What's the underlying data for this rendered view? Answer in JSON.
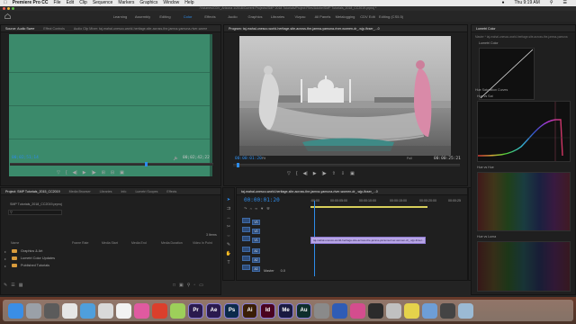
{
  "menubar": {
    "apple": "",
    "app": "Premiere Pro CC",
    "items": [
      "File",
      "Edit",
      "Clip",
      "Sequence",
      "Markers",
      "Graphics",
      "Window",
      "Help"
    ],
    "clock": "Thu 9:19 AM"
  },
  "titlebar": {
    "path": "/Volumes/CDV_Arizona 1/2018/Current Projects/SMP 2018 Tutorials/Project Files/Adobe/SMP Tutorials_2018_CC2019.prproj *"
  },
  "workspaces": {
    "tabs": [
      "Learning",
      "Assembly",
      "Editing",
      "Color",
      "Effects",
      "Audio",
      "Graphics",
      "Libraries",
      "Vizpac",
      "All Panels",
      "Metalogging",
      "CDV Edit",
      "Editing (CS5.5)"
    ],
    "active": "Color"
  },
  "source_panel": {
    "tabs": [
      "Source: Audio Swee",
      "Effect Controls",
      "Audio Clip Mixer: taj-mahal-unesco-world-heritage-site-across-the-jamna-yamuna-river-wome"
    ],
    "timecode_left": "00;02;51;14",
    "timecode_right": "00;02;42;22"
  },
  "program_panel": {
    "title": "Program: taj-mahal-unesco-world-heritage-site-across-the-jamna-yamuna-river-women-dr_.wjp-ifcser_...0",
    "timecode_left": "00:00:01:20",
    "fit_label": "Fit",
    "quality_label": "Full",
    "timecode_right": "00:00:25:21"
  },
  "project_panel": {
    "tabs": [
      "Project: SMP Tutorials_2015_CC2019",
      "Media Browser",
      "Libraries",
      "Info",
      "Lumetri Scopes",
      "Effects"
    ],
    "project_file": "SMP Tutorials_2018_CC2019.prproj",
    "item_count": "3 Items",
    "columns": [
      "Name",
      "Frame Rate",
      "Media Start",
      "Media End",
      "Media Duration",
      "Video In Point"
    ],
    "rows": [
      {
        "name": "Graphics & Art"
      },
      {
        "name": "Lumetri Color Updates"
      },
      {
        "name": "Published Tutorials"
      }
    ]
  },
  "timeline_panel": {
    "sequence_tab": "taj-mahal-unesco-world-heritage-site-across-the-jamna-yamuna-river-women-dr_.wjp-ifcser_...0",
    "timecode": "00:00:01:20",
    "ruler": [
      ":00:00",
      "00:00:05:00",
      "00:00:10:00",
      "00:00:15:00",
      "00:00:20:00",
      "00:00:25"
    ],
    "tracks": [
      "V3",
      "V2",
      "V1",
      "A1",
      "A2",
      "A3"
    ],
    "master_label": "Master",
    "master_value": "0.0",
    "clip_label": "taj-mahal-unesco-world-heritage-site-across-the-jamna-yamuna-river-women-dr_.wjp-ifcser..."
  },
  "lumetri_panel": {
    "tab": "Lumetri Color",
    "master_label": "Master * taj-mahal-unesco-world-heritage-site-across-the-jamna-yamuna",
    "section_color": "Lumetri Color",
    "section_hsl": "Hue Saturation Curves",
    "curve_labels": [
      "Hue vs Sat",
      "Hue vs Hue",
      "Hue vs Luma"
    ]
  },
  "dock": {
    "apps": [
      {
        "label": "",
        "color": "#3a8ee6"
      },
      {
        "label": "",
        "color": "#9aa0a8"
      },
      {
        "label": "",
        "color": "#5b5b5b"
      },
      {
        "label": "",
        "color": "#e6e6e6"
      },
      {
        "label": "",
        "color": "#4f9fdc"
      },
      {
        "label": "",
        "color": "#d9d9d9"
      },
      {
        "label": "",
        "color": "#f2f2f2"
      },
      {
        "label": "",
        "color": "#e05aa0"
      },
      {
        "label": "",
        "color": "#db3f2c"
      },
      {
        "label": "",
        "color": "#9dcf5a"
      },
      {
        "label": "Pr",
        "color": "#2a1a4e"
      },
      {
        "label": "Ae",
        "color": "#2a1a4e"
      },
      {
        "label": "Ps",
        "color": "#0c2a4a"
      },
      {
        "label": "Ai",
        "color": "#3a1e05"
      },
      {
        "label": "Id",
        "color": "#49021f"
      },
      {
        "label": "Me",
        "color": "#1a1a40"
      },
      {
        "label": "Au",
        "color": "#0e2e2c"
      },
      {
        "label": "",
        "color": "#8a8a8a"
      },
      {
        "label": "",
        "color": "#2f5cb5"
      },
      {
        "label": "",
        "color": "#d44d8e"
      },
      {
        "label": "",
        "color": "#2b2b2b"
      },
      {
        "label": "",
        "color": "#c0c0c0"
      },
      {
        "label": "",
        "color": "#e5d24b"
      },
      {
        "label": "",
        "color": "#6e9ed6"
      },
      {
        "label": "",
        "color": "#444"
      },
      {
        "label": "",
        "color": "#9bbad4"
      }
    ]
  }
}
